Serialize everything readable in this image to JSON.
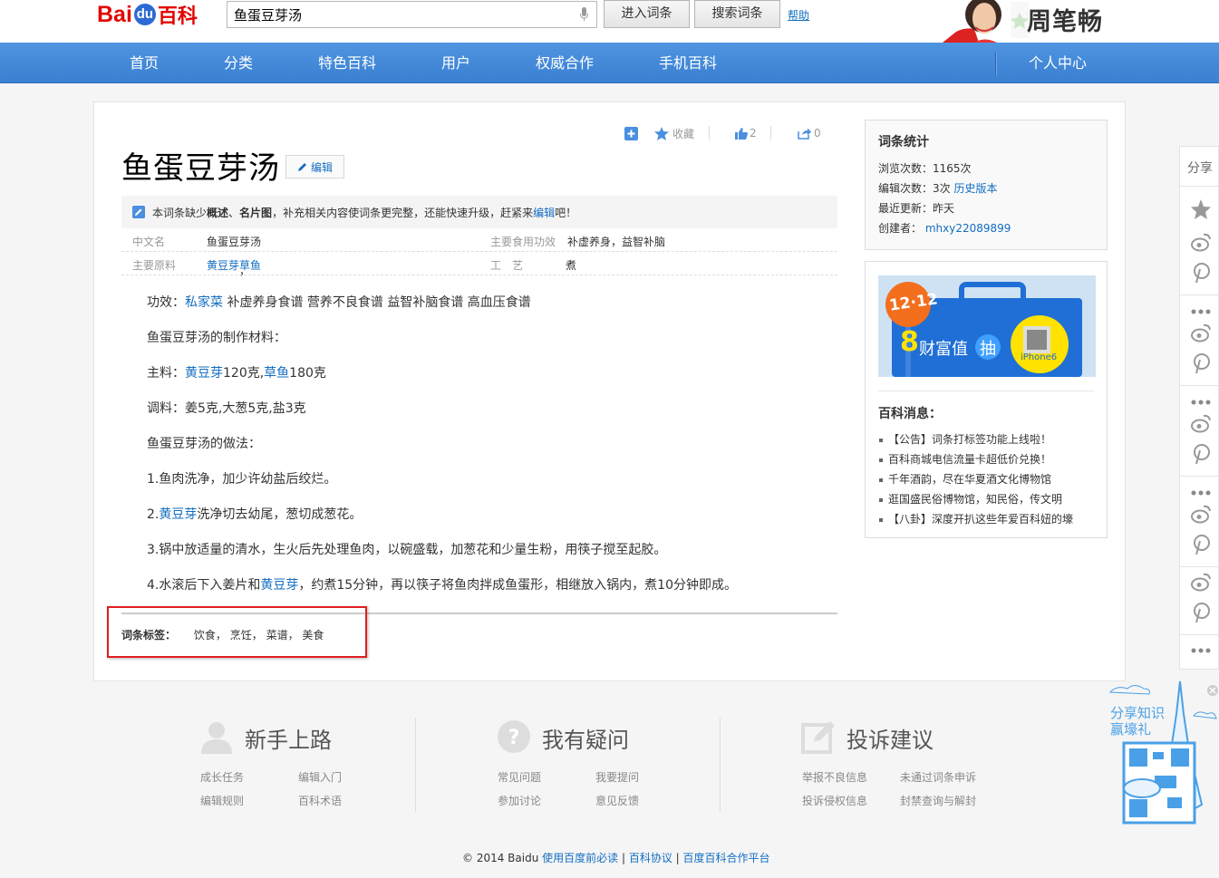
{
  "header": {
    "logo_bai": "Bai",
    "logo_du": "du",
    "logo_baike": "百科",
    "search_value": "鱼蛋豆芽汤",
    "enter_button": "进入词条",
    "search_button": "搜索词条",
    "help_link": "帮助",
    "celebrity_name": "周笔畅"
  },
  "nav": {
    "items": [
      "首页",
      "分类",
      "特色百科",
      "用户",
      "权威合作",
      "手机百科"
    ],
    "user_center": "个人中心"
  },
  "tools": {
    "collect": "收藏",
    "like_count": "2",
    "share_count": "0"
  },
  "entry": {
    "title": "鱼蛋豆芽汤",
    "edit_button": "编辑",
    "notice_prefix": "本词条缺少",
    "notice_b1": "概述",
    "notice_sep": "、",
    "notice_b2": "名片图",
    "notice_mid": "，补充相关内容使词条更完整，还能快速升级，赶紧来",
    "notice_link": "编辑",
    "notice_suffix": "吧！",
    "info": {
      "cn_name_key": "中文名",
      "cn_name_val": "鱼蛋豆芽汤",
      "effect_key": "主要食用功效",
      "effect_val": "补虚养身，益智补脑",
      "ingredient_key": "主要原料",
      "ingredient_val1": "黄豆芽",
      "ingredient_sep": "，",
      "ingredient_val2": "草鱼",
      "craft_key": "工　艺",
      "craft_val": "煮"
    },
    "p1_prefix": "功效：",
    "p1_link": "私家菜",
    "p1_rest": " 补虚养身食谱 营养不良食谱 益智补脑食谱 高血压食谱",
    "p2": "鱼蛋豆芽汤的制作材料：",
    "p3_prefix": "主料：",
    "p3_link1": "黄豆芽",
    "p3_mid": "120克,",
    "p3_link2": "草鱼",
    "p3_end": "180克",
    "p4": "调料：姜5克,大葱5克,盐3克",
    "p5": "鱼蛋豆芽汤的做法：",
    "p6": "1.鱼肉洗净，加少许幼盐后绞烂。",
    "p7_prefix": "2.",
    "p7_link": "黄豆芽",
    "p7_rest": "洗净切去幼尾，葱切成葱花。",
    "p8": "3.锅中放适量的清水，生火后先处理鱼肉，以碗盛载，加葱花和少量生粉，用筷子搅至起胶。",
    "p9_prefix": "4.水滚后下入姜片和",
    "p9_link": "黄豆芽",
    "p9_rest": "，约煮15分钟，再以筷子将鱼肉拌成鱼蛋形，相继放入锅内，煮10分钟即成。",
    "tags_label": "词条标签：",
    "tags": [
      "饮食",
      "烹饪",
      "菜谱",
      "美食"
    ],
    "tag_sep": "，"
  },
  "stats": {
    "title": "词条统计",
    "views_label": "浏览次数：",
    "views_val": "1165次",
    "edits_label": "编辑次数：",
    "edits_val": "3次",
    "history_link": "历史版本",
    "updated_label": "最近更新：",
    "updated_val": "昨天",
    "creator_label": "创建者：",
    "creator_val": "mhxy22089899"
  },
  "banner": {
    "badge": "12·12",
    "big_num": "8",
    "text": "财富值",
    "draw": "抽",
    "phone": "iPhone6"
  },
  "news": {
    "title": "百科消息：",
    "items": [
      "【公告】词条打标签功能上线啦！",
      "百科商城电信流量卡超低价兑换！",
      "千年酒韵，尽在华夏酒文化博物馆",
      "逛国盛民俗博物馆，知民俗，传文明",
      "【八卦】深度开扒这些年爱百科妞的壕"
    ]
  },
  "share": {
    "label": "分享"
  },
  "footer": {
    "col1_title": "新手上路",
    "col1_links": [
      "成长任务",
      "编辑入门",
      "编辑规则",
      "百科术语"
    ],
    "col2_title": "我有疑问",
    "col2_links": [
      "常见问题",
      "我要提问",
      "参加讨论",
      "意见反馈"
    ],
    "col3_title": "投诉建议",
    "col3_links": [
      "举报不良信息",
      "未通过词条申诉",
      "投诉侵权信息",
      "封禁查询与解封"
    ],
    "copyright": "© 2014 Baidu ",
    "links": [
      "使用百度前必读",
      "百科协议",
      "百度百科合作平台"
    ],
    "link_sep": " | "
  },
  "promo": {
    "line1": "分享知识",
    "line2": "赢壕礼"
  },
  "colors": {
    "nav_blue": "#3a7fd1",
    "link": "#136ec2",
    "logo_red": "#e10601",
    "highlight": "#e02020"
  }
}
